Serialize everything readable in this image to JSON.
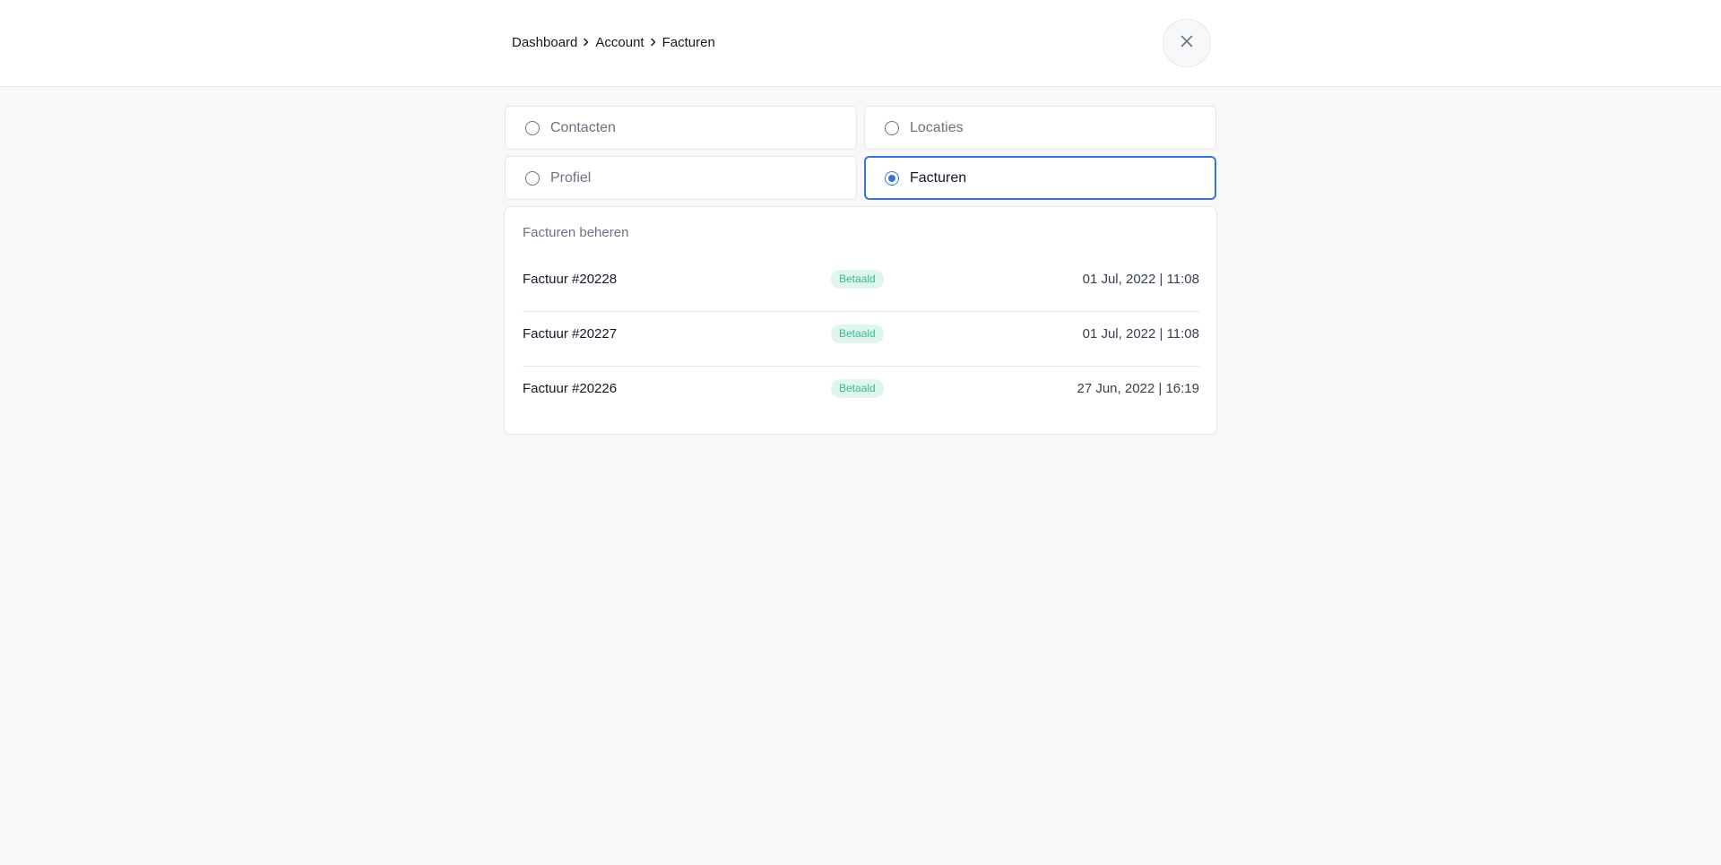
{
  "breadcrumb": {
    "items": [
      "Dashboard",
      "Account",
      "Facturen"
    ]
  },
  "close_button": {
    "icon": "close-icon"
  },
  "options": [
    {
      "label": "Contacten",
      "selected": false
    },
    {
      "label": "Locaties",
      "selected": false
    },
    {
      "label": "Profiel",
      "selected": false
    },
    {
      "label": "Facturen",
      "selected": true
    }
  ],
  "panel": {
    "title": "Facturen beheren",
    "invoices": [
      {
        "name": "Factuur #20228",
        "status": "Betaald",
        "date": "01 Jul, 2022 | 11:08"
      },
      {
        "name": "Factuur #20227",
        "status": "Betaald",
        "date": "01 Jul, 2022 | 11:08"
      },
      {
        "name": "Factuur #20226",
        "status": "Betaald",
        "date": "27 Jun, 2022 | 16:19"
      }
    ]
  },
  "colors": {
    "accent": "#3b74d9",
    "badge_bg": "#dff6ee",
    "badge_text": "#3cb98a",
    "page_bg": "#f7f8fa"
  }
}
